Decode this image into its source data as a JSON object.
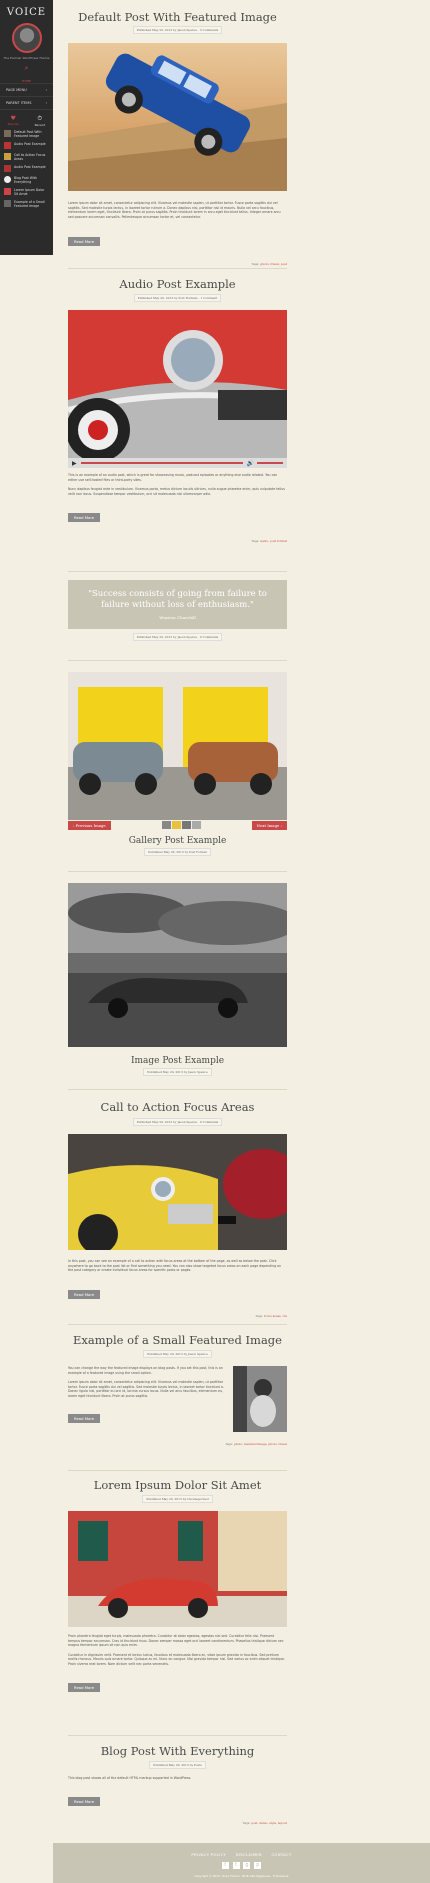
{
  "sidebar": {
    "logo": "VOICE",
    "tagline": "The Premier WordPress Theme",
    "home": "HOME",
    "menu": [
      {
        "label": "PAGE MENU",
        "arrow": "›"
      },
      {
        "label": "PARENT ITEMS",
        "arrow": "›"
      }
    ],
    "tabs": [
      {
        "label": "Popular",
        "icon": "♥"
      },
      {
        "label": "Recent",
        "icon": "⏱"
      }
    ],
    "popular_posts": [
      "Default Post With Featured Image",
      "Audio Post Example",
      "Call to Action Focus Areas",
      "Audio Post Example",
      "Blog Post With Everything",
      "Lorem Ipsum Dolor Sit Amet",
      "Example of a Small Featured Image"
    ]
  },
  "posts": [
    {
      "title": "Default Post With Featured Image",
      "meta": "Published May 20, 2013 by Jason Spence · 3 Comments",
      "excerpt": "Lorem ipsum dolor sit amet, consectetur adipiscing elit. Vivamus vel molestie sapien, ut porttitor tortor. Fusce porta sagittis dui vel sagittis. Sed molestie turpis lectus, in laoreet tortor rutrum a. Donec dapibus nisl, porttitor nisi id mauris. Nulla vel arcu faucibus, elementum lorem eget, tincidunt libero. Proin at purus sagittis. Proin tincidunt lorem in arcu eget tincidunt tellus. Integer ornare arcu sed posuere accumsan convallis. Pellentesque accumsan tortor et, vel consectetur.",
      "read_more": "Read More",
      "tags_prefix": "Tags:",
      "tags": "photo, travel, post"
    },
    {
      "title": "Audio Post Example",
      "meta": "Published May 20, 2013 by Post Formats · 1 Comment",
      "excerpt_1": "This is an example of an audio post, which is great for showcasing music, podcast episodes or anything else audio related. You can either use self-hosted files or third-party sites.",
      "excerpt_2": "Nunc dapibus feugiat ante in vestibulum. Vivamus porta, metus dictum iaculis ultrices, nulla augue pharetra enim, quis vulputate tellus velit non lacus. Suspendisse tempor vestibulum, orci sit malesuada nisi ullamcorper odio.",
      "read_more": "Read More",
      "tags_prefix": "Tags:",
      "tags": "audio, post format",
      "audio_play": "▶",
      "audio_vol": "🔊"
    },
    {
      "quote": "\"Success consists of going from failure to failure without loss of enthusiasm.\"",
      "author": "Winston Churchill",
      "meta": "Published May 20, 2013 by Jason Spence · 0 Comments"
    },
    {
      "title": "Gallery Post Example",
      "meta": "Published May 20, 2013 by Post Format",
      "prev": "‹ Previous Image",
      "next": "Next Image ›"
    },
    {
      "title": "Image Post Example",
      "meta": "Published May 20, 2013 by Jason Spence"
    },
    {
      "title": "Call to Action Focus Areas",
      "meta": "Published May 20, 2013 by Jason Spence · 0 Comments",
      "excerpt": "In this post, you can see an example of a call to action with focus areas at the bottom of the page, as well as below the post. Click anywhere to go back to the post list or find something you need. You can also show targeted focus areas on each page depending on the post category or create individual focus areas for specific posts or pages.",
      "read_more": "Read More",
      "tags_prefix": "Tags:",
      "tags": "focus areas, cta"
    },
    {
      "title": "Example of a Small Featured Image",
      "meta": "Published May 20, 2013 by Jason Spence",
      "excerpt_1": "You can change the way the featured image displays on blog posts. If you set this post, this is an example of a featured image using the small option.",
      "excerpt_2": "Lorem ipsum dolor sit amet, consectetur adipiscing elit. Vivamus vel molestie sapien, ut porttitor tortor. Fusce porta sagittis dui vel sagittis. Sed molestie turpis lectus, in laoreet tortor tincidunt a. Donec ligula nisl, porttitor eu orci id, lacinia cursus lacus. Nulla vel arcu faucibus, elementum eu, lorem eget tincidunt libero. Proin at purus sagittis.",
      "read_more": "Read More",
      "tags_prefix": "Tags:",
      "tags": "photo, featured image, photo, travel"
    },
    {
      "title": "Lorem Ipsum Dolor Sit Amet",
      "meta": "Published May 20, 2013 by Uncategorized",
      "excerpt_1": "Proin pharetra feugiat eget turpis, malesuada pharetra. Curabitur at dolor egestas, egestas nisi sed. Curabitur felis nisi. Praesent tempus tempor accumsan. Cras id tincidunt risus. Donec semper massa eget orci laoreet condimentum. Phasellus tristique dictum nec magna fermentum ipsum sit non quis enim.",
      "excerpt_2": "Curabitur in dignissim velit. Praesent et lectus luctus, faucibus et malesuada libero ac, vitae ipsum gravida in faucibus. Sed pretium mollis rhoncus. Mauris quis ornare tortor. Quisque ac mi. Nunc eu congue. Nisi gravida tempor nisl. Sed varius ac enim aliquet tristique. Proin viverra erat lorem. Nam dictum velit nec porta venenatis.",
      "read_more": "Read More"
    },
    {
      "title": "Blog Post With Everything",
      "meta": "Published May 20, 2013 by Posts",
      "excerpt": "This blog post shows all of the default HTML markup supported in WordPress.",
      "read_more": "Read More",
      "tags_prefix": "Tags:",
      "tags": "post, demo, style, layout"
    }
  ],
  "footer": {
    "links": [
      "PRIVACY POLICY",
      "DISCLAIMER",
      "CONTACT"
    ],
    "social": [
      "f",
      "t",
      "g",
      "p"
    ],
    "copyright": "Copyright © 2013. Voice Theme · Built with PageLines · Framework"
  },
  "colors": {
    "accent": "#c94848",
    "background": "#f3efe2",
    "sidebar": "#2b2b2b",
    "quote_bg": "#c9c5b4"
  }
}
